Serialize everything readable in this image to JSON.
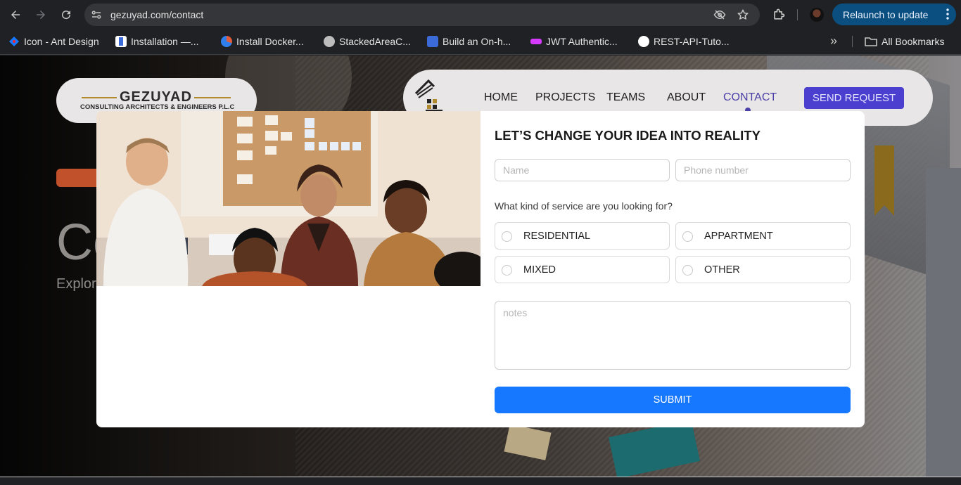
{
  "browser": {
    "url": "gezuyad.com/contact",
    "relaunch_label": "Relaunch to update",
    "bookmarks": [
      {
        "label": "Icon - Ant Design",
        "icon": "ant-design-icon",
        "color": "#1677ff"
      },
      {
        "label": "Installation —...",
        "icon": "docs-icon",
        "color": "#ffffff"
      },
      {
        "label": "Install Docker...",
        "icon": "globe-blue-icon",
        "color": "#e25c3c"
      },
      {
        "label": "StackedAreaC...",
        "icon": "globe-icon",
        "color": "#bdbdbd"
      },
      {
        "label": "Build an On-h...",
        "icon": "co-icon",
        "color": "#3b6bd9"
      },
      {
        "label": "JWT Authentic...",
        "icon": "jwt-icon",
        "color": "#d63aff"
      },
      {
        "label": "REST-API-Tuto...",
        "icon": "github-icon",
        "color": "#ffffff"
      }
    ],
    "all_bookmarks_label": "All Bookmarks"
  },
  "site": {
    "logo_text": "GEZUYAD",
    "logo_tagline": "CONSULTING ARCHITECTS & ENGINEERS P.L.C",
    "nav": [
      "HOME",
      "PROJECTS",
      "TEAMS",
      "ABOUT",
      "CONTACT"
    ],
    "active_nav": "CONTACT",
    "send_request_label": "SEND REQUEST",
    "hero_title_partial": "Co",
    "hero_subtitle_partial": "Explor"
  },
  "modal": {
    "title": "LET’S CHANGE YOUR IDEA INTO REALITY",
    "name_placeholder": "Name",
    "phone_placeholder": "Phone number",
    "question": "What kind of service are you looking for?",
    "options": [
      "RESIDENTIAL",
      "APPARTMENT",
      "MIXED",
      "OTHER"
    ],
    "notes_placeholder": "notes",
    "submit_label": "SUBMIT"
  },
  "colors": {
    "accent": "#1677ff",
    "nav_active": "#4a3fa6",
    "send_button": "#4a3fcf",
    "relaunch": "#0b4f80"
  }
}
